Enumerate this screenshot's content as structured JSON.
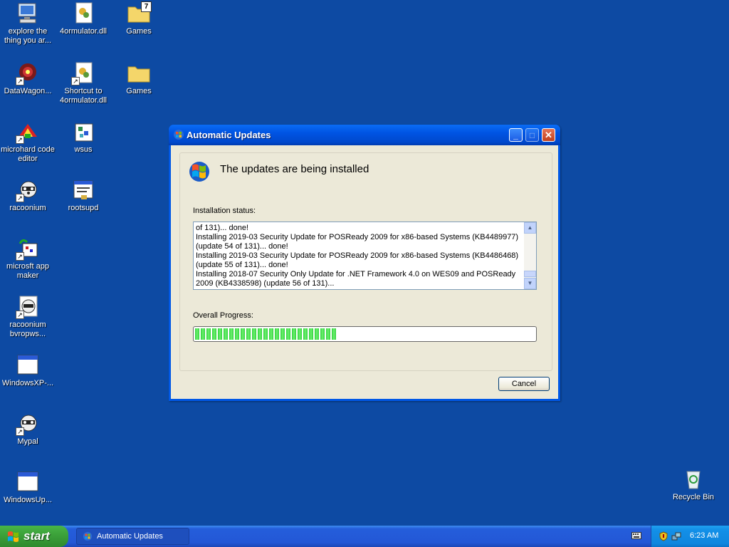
{
  "desktop": {
    "icons": [
      {
        "label": "explore the thing you ar...",
        "icon": "computer-icon"
      },
      {
        "label": "4ormulator.dll",
        "icon": "dll-icon"
      },
      {
        "label": "Games",
        "icon": "folder-icon"
      },
      {
        "label": "DataWagon...",
        "icon": "web-icon"
      },
      {
        "label": "Shortcut to 4ormulator.dll",
        "icon": "dll-icon"
      },
      {
        "label": "Games",
        "icon": "folder-icon"
      },
      {
        "label": "microhard code editor",
        "icon": "app-icon"
      },
      {
        "label": "wsus",
        "icon": "script-icon"
      },
      {
        "label": "racoonium",
        "icon": "raccoon-icon"
      },
      {
        "label": "rootsupd",
        "icon": "window-icon"
      },
      {
        "label": "microsft app maker",
        "icon": "app-icon"
      },
      {
        "label": "racoonium bvropws...",
        "icon": "raccoon-icon"
      },
      {
        "label": "WindowsXP-...",
        "icon": "window-icon"
      },
      {
        "label": "Mypal",
        "icon": "raccoon-icon"
      },
      {
        "label": "WindowsUp...",
        "icon": "window-icon"
      },
      {
        "label": "Recycle Bin",
        "icon": "recycle-bin-icon"
      }
    ],
    "folder_badge": "7"
  },
  "dialog": {
    "title": "Automatic Updates",
    "heading": "The updates are being installed",
    "status_label": "Installation status:",
    "log_lines": [
      "of 131)... done!",
      "Installing 2019-03 Security Update for POSReady 2009 for x86-based Systems (KB4489977) (update 54 of 131)... done!",
      "Installing 2019-03 Security Update for POSReady 2009 for x86-based Systems (KB4486468) (update 55 of 131)... done!",
      "Installing 2018-07 Security Only Update for .NET Framework 4.0 on WES09 and POSReady 2009 (KB4338598) (update 56 of 131)..."
    ],
    "progress_label": "Overall Progress:",
    "progress_fraction": 0.415,
    "cancel_label": "Cancel"
  },
  "taskbar": {
    "start_label": "start",
    "task_label": "Automatic Updates",
    "clock": "6:23 AM"
  },
  "colors": {
    "desktop": "#0d4aa3",
    "title_bar": "#0054e3",
    "progress_green": "#2fd23c",
    "dialog_face": "#ece9d8"
  }
}
